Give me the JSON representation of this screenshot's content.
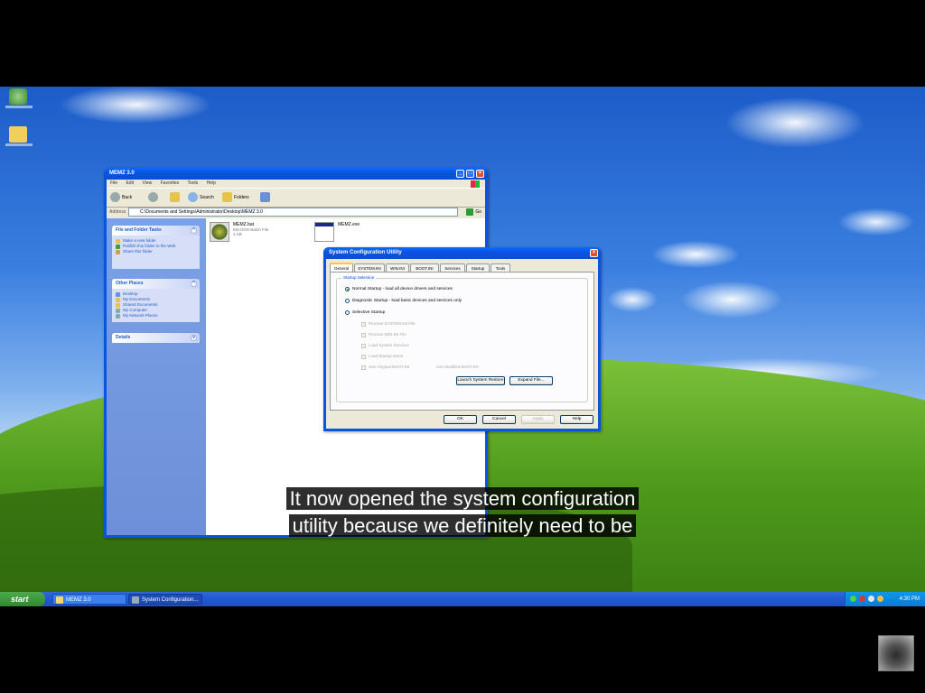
{
  "explorer": {
    "title": "MEMZ 3.0",
    "menu": [
      "File",
      "Edit",
      "View",
      "Favorites",
      "Tools",
      "Help"
    ],
    "toolbar": {
      "back": "Back",
      "search": "Search",
      "folders": "Folders"
    },
    "address_label": "Address",
    "address": "C:\\Documents and Settings\\Administrator\\Desktop\\MEMZ 3.0",
    "go": "Go",
    "tasks_title": "File and Folder Tasks",
    "tasks": [
      "Make a new folder",
      "Publish this folder to the Web",
      "Share this folder"
    ],
    "places_title": "Other Places",
    "places": [
      "Desktop",
      "My Documents",
      "Shared Documents",
      "My Computer",
      "My Network Places"
    ],
    "details_title": "Details",
    "files": [
      {
        "name": "MEMZ.bat",
        "type": "MS-DOS Batch File",
        "size": "1 KB"
      },
      {
        "name": "MEMZ.exe",
        "type": "",
        "size": ""
      }
    ]
  },
  "dialog": {
    "title": "System Configuration Utility",
    "tabs": [
      "General",
      "SYSTEM.INI",
      "WIN.INI",
      "BOOT.INI",
      "Services",
      "Startup",
      "Tools"
    ],
    "group_title": "Startup Selection",
    "options": [
      "Normal Startup - load all device drivers and services",
      "Diagnostic Startup - load basic devices and services only",
      "Selective Startup"
    ],
    "checks": [
      "Process SYSTEM.INI File",
      "Process WIN.INI File",
      "Load System Services",
      "Load Startup Items",
      "Use Original BOOT.INI"
    ],
    "modified_boot": "Use Modified BOOT.INI",
    "buttons": {
      "launch": "Launch System Restore",
      "expand": "Expand File...",
      "ok": "OK",
      "cancel": "Cancel",
      "apply": "Apply",
      "help": "Help"
    }
  },
  "taskbar": {
    "start": "start",
    "items": [
      "MEMZ 3.0",
      "System Configuration..."
    ],
    "clock": "4:30 PM"
  },
  "caption": {
    "line1": "It now opened the system configuration",
    "line2": "utility because we definitely need to be"
  }
}
